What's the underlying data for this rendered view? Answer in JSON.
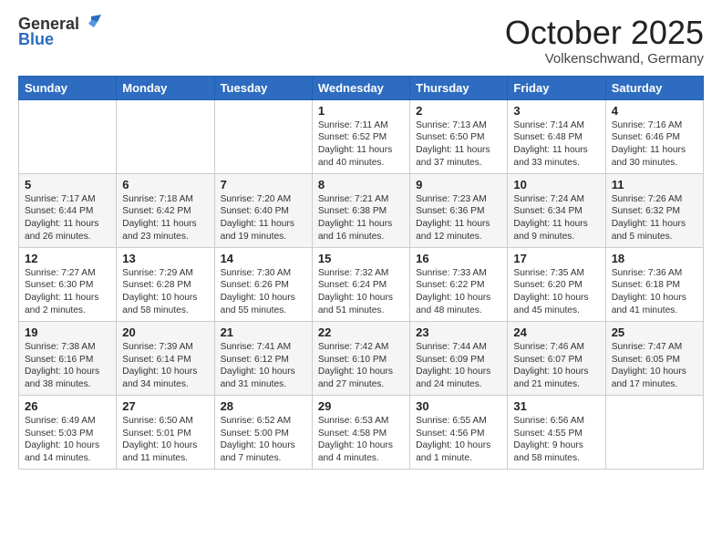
{
  "header": {
    "logo_line1": "General",
    "logo_line2": "Blue",
    "title": "October 2025",
    "subtitle": "Volkenschwand, Germany"
  },
  "weekdays": [
    "Sunday",
    "Monday",
    "Tuesday",
    "Wednesday",
    "Thursday",
    "Friday",
    "Saturday"
  ],
  "weeks": [
    [
      {
        "day": "",
        "info": ""
      },
      {
        "day": "",
        "info": ""
      },
      {
        "day": "",
        "info": ""
      },
      {
        "day": "1",
        "info": "Sunrise: 7:11 AM\nSunset: 6:52 PM\nDaylight: 11 hours\nand 40 minutes."
      },
      {
        "day": "2",
        "info": "Sunrise: 7:13 AM\nSunset: 6:50 PM\nDaylight: 11 hours\nand 37 minutes."
      },
      {
        "day": "3",
        "info": "Sunrise: 7:14 AM\nSunset: 6:48 PM\nDaylight: 11 hours\nand 33 minutes."
      },
      {
        "day": "4",
        "info": "Sunrise: 7:16 AM\nSunset: 6:46 PM\nDaylight: 11 hours\nand 30 minutes."
      }
    ],
    [
      {
        "day": "5",
        "info": "Sunrise: 7:17 AM\nSunset: 6:44 PM\nDaylight: 11 hours\nand 26 minutes."
      },
      {
        "day": "6",
        "info": "Sunrise: 7:18 AM\nSunset: 6:42 PM\nDaylight: 11 hours\nand 23 minutes."
      },
      {
        "day": "7",
        "info": "Sunrise: 7:20 AM\nSunset: 6:40 PM\nDaylight: 11 hours\nand 19 minutes."
      },
      {
        "day": "8",
        "info": "Sunrise: 7:21 AM\nSunset: 6:38 PM\nDaylight: 11 hours\nand 16 minutes."
      },
      {
        "day": "9",
        "info": "Sunrise: 7:23 AM\nSunset: 6:36 PM\nDaylight: 11 hours\nand 12 minutes."
      },
      {
        "day": "10",
        "info": "Sunrise: 7:24 AM\nSunset: 6:34 PM\nDaylight: 11 hours\nand 9 minutes."
      },
      {
        "day": "11",
        "info": "Sunrise: 7:26 AM\nSunset: 6:32 PM\nDaylight: 11 hours\nand 5 minutes."
      }
    ],
    [
      {
        "day": "12",
        "info": "Sunrise: 7:27 AM\nSunset: 6:30 PM\nDaylight: 11 hours\nand 2 minutes."
      },
      {
        "day": "13",
        "info": "Sunrise: 7:29 AM\nSunset: 6:28 PM\nDaylight: 10 hours\nand 58 minutes."
      },
      {
        "day": "14",
        "info": "Sunrise: 7:30 AM\nSunset: 6:26 PM\nDaylight: 10 hours\nand 55 minutes."
      },
      {
        "day": "15",
        "info": "Sunrise: 7:32 AM\nSunset: 6:24 PM\nDaylight: 10 hours\nand 51 minutes."
      },
      {
        "day": "16",
        "info": "Sunrise: 7:33 AM\nSunset: 6:22 PM\nDaylight: 10 hours\nand 48 minutes."
      },
      {
        "day": "17",
        "info": "Sunrise: 7:35 AM\nSunset: 6:20 PM\nDaylight: 10 hours\nand 45 minutes."
      },
      {
        "day": "18",
        "info": "Sunrise: 7:36 AM\nSunset: 6:18 PM\nDaylight: 10 hours\nand 41 minutes."
      }
    ],
    [
      {
        "day": "19",
        "info": "Sunrise: 7:38 AM\nSunset: 6:16 PM\nDaylight: 10 hours\nand 38 minutes."
      },
      {
        "day": "20",
        "info": "Sunrise: 7:39 AM\nSunset: 6:14 PM\nDaylight: 10 hours\nand 34 minutes."
      },
      {
        "day": "21",
        "info": "Sunrise: 7:41 AM\nSunset: 6:12 PM\nDaylight: 10 hours\nand 31 minutes."
      },
      {
        "day": "22",
        "info": "Sunrise: 7:42 AM\nSunset: 6:10 PM\nDaylight: 10 hours\nand 27 minutes."
      },
      {
        "day": "23",
        "info": "Sunrise: 7:44 AM\nSunset: 6:09 PM\nDaylight: 10 hours\nand 24 minutes."
      },
      {
        "day": "24",
        "info": "Sunrise: 7:46 AM\nSunset: 6:07 PM\nDaylight: 10 hours\nand 21 minutes."
      },
      {
        "day": "25",
        "info": "Sunrise: 7:47 AM\nSunset: 6:05 PM\nDaylight: 10 hours\nand 17 minutes."
      }
    ],
    [
      {
        "day": "26",
        "info": "Sunrise: 6:49 AM\nSunset: 5:03 PM\nDaylight: 10 hours\nand 14 minutes."
      },
      {
        "day": "27",
        "info": "Sunrise: 6:50 AM\nSunset: 5:01 PM\nDaylight: 10 hours\nand 11 minutes."
      },
      {
        "day": "28",
        "info": "Sunrise: 6:52 AM\nSunset: 5:00 PM\nDaylight: 10 hours\nand 7 minutes."
      },
      {
        "day": "29",
        "info": "Sunrise: 6:53 AM\nSunset: 4:58 PM\nDaylight: 10 hours\nand 4 minutes."
      },
      {
        "day": "30",
        "info": "Sunrise: 6:55 AM\nSunset: 4:56 PM\nDaylight: 10 hours\nand 1 minute."
      },
      {
        "day": "31",
        "info": "Sunrise: 6:56 AM\nSunset: 4:55 PM\nDaylight: 9 hours\nand 58 minutes."
      },
      {
        "day": "",
        "info": ""
      }
    ]
  ]
}
